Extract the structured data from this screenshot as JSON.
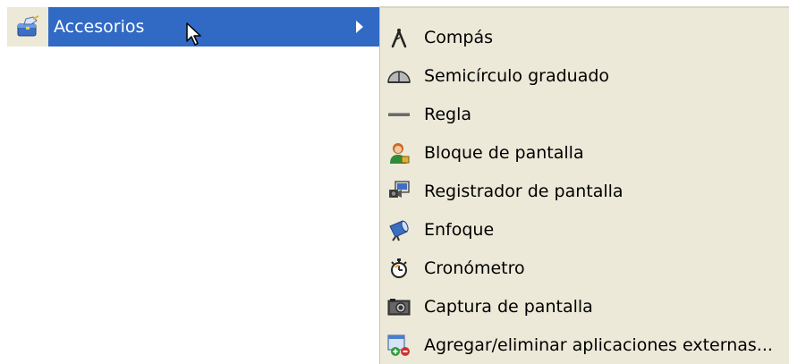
{
  "parent_menu": {
    "label": "Accesorios",
    "icon": "accessories-toolbox-icon"
  },
  "submenu": {
    "items": [
      {
        "label": "Compás",
        "icon": "compass-icon"
      },
      {
        "label": "Semicírculo graduado",
        "icon": "protractor-icon"
      },
      {
        "label": "Regla",
        "icon": "ruler-icon"
      },
      {
        "label": "Bloque de pantalla",
        "icon": "screen-lock-person-icon"
      },
      {
        "label": "Registrador de pantalla",
        "icon": "screen-recorder-icon"
      },
      {
        "label": "Enfoque",
        "icon": "spotlight-icon"
      },
      {
        "label": "Cronómetro",
        "icon": "stopwatch-icon"
      },
      {
        "label": "Captura de pantalla",
        "icon": "camera-icon"
      },
      {
        "label": "Agregar/eliminar aplicaciones externas...",
        "icon": "add-remove-apps-icon"
      }
    ]
  },
  "colors": {
    "highlight": "#316ac5",
    "menu_background": "#ece9d8",
    "highlight_text": "#ffffff"
  }
}
